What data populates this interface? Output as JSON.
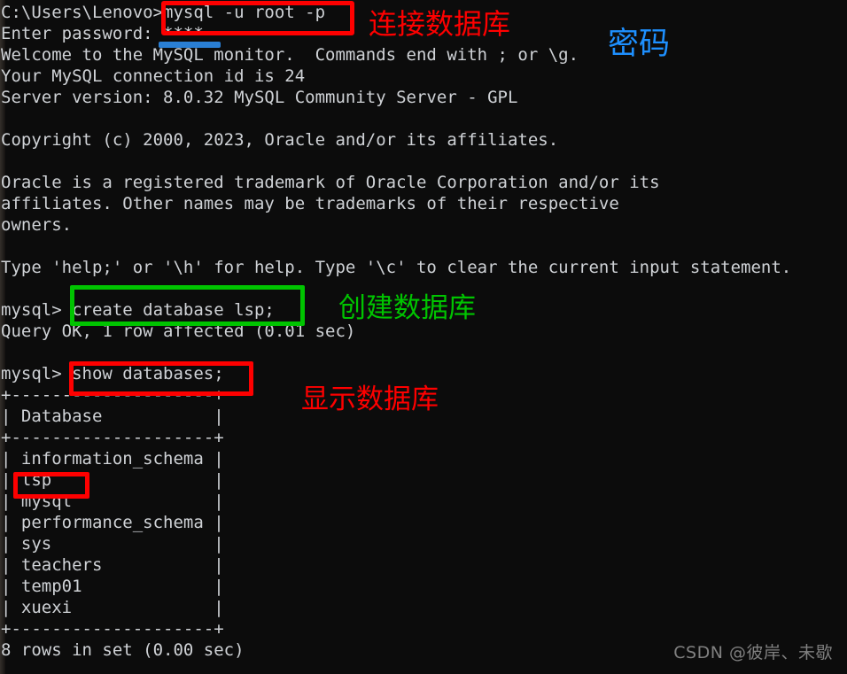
{
  "terminal": {
    "background_color": "#0c0c0c",
    "text_color": "#cfd2d6",
    "lines": [
      "C:\\Users\\Lenovo>mysql -u root -p",
      "Enter password: ****",
      "Welcome to the MySQL monitor.  Commands end with ; or \\g.",
      "Your MySQL connection id is 24",
      "Server version: 8.0.32 MySQL Community Server - GPL",
      "",
      "Copyright (c) 2000, 2023, Oracle and/or its affiliates.",
      "",
      "Oracle is a registered trademark of Oracle Corporation and/or its",
      "affiliates. Other names may be trademarks of their respective",
      "owners.",
      "",
      "Type 'help;' or '\\h' for help. Type '\\c' to clear the current input statement.",
      "",
      "mysql> create database lsp;",
      "Query OK, 1 row affected (0.01 sec)",
      "",
      "mysql> show databases;",
      "+--------------------+",
      "| Database           |",
      "+--------------------+",
      "| information_schema |",
      "| lsp                |",
      "| mysql              |",
      "| performance_schema |",
      "| sys                |",
      "| teachers           |",
      "| temp01             |",
      "| xuexi              |",
      "+--------------------+",
      "8 rows in set (0.00 sec)"
    ]
  },
  "command_prompt": "C:\\Users\\Lenovo>",
  "commands": {
    "connect": "mysql -u root -p",
    "password_prompt": "Enter password:",
    "password_masked": "****",
    "create_db": "create database lsp;",
    "create_db_result": "Query OK, 1 row affected (0.01 sec)",
    "show_db": "show databases;",
    "show_db_result": "8 rows in set (0.00 sec)"
  },
  "server_info": {
    "welcome": "Welcome to the MySQL monitor.  Commands end with ; or \\g.",
    "connection_id": "Your MySQL connection id is 24",
    "version": "Server version: 8.0.32 MySQL Community Server - GPL",
    "copyright": "Copyright (c) 2000, 2023, Oracle and/or its affiliates.",
    "trademark_1": "Oracle is a registered trademark of Oracle Corporation and/or its",
    "trademark_2": "affiliates. Other names may be trademarks of their respective",
    "trademark_3": "owners.",
    "help": "Type 'help;' or '\\h' for help. Type '\\c' to clear the current input statement."
  },
  "database_table": {
    "header": "Database",
    "separator": "+--------------------+",
    "rows": [
      "information_schema",
      "lsp",
      "mysql",
      "performance_schema",
      "sys",
      "teachers",
      "temp01",
      "xuexi"
    ],
    "row_count_text": "8 rows in set (0.00 sec)"
  },
  "annotations": {
    "colors": {
      "red": "#fe0000",
      "green": "#00c400",
      "blue": "#1e90ff"
    },
    "connect_label": "连接数据库",
    "password_label": "密码",
    "create_label": "创建数据库",
    "show_label": "显示数据库"
  },
  "watermark": "CSDN @彼岸、未歇"
}
